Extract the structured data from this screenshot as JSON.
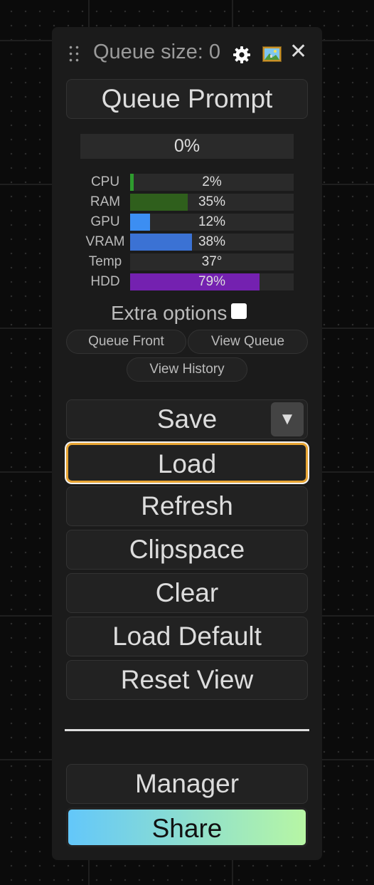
{
  "header": {
    "queue_size_label": "Queue size: 0",
    "gear_icon": "gear-icon",
    "picture_icon": "picture-icon",
    "close_icon": "close-icon",
    "close_glyph": "✕"
  },
  "queue_prompt_label": "Queue Prompt",
  "progress": {
    "value": 0,
    "label": "0%"
  },
  "stats": [
    {
      "name": "CPU",
      "value_label": "2%",
      "fraction": 0.02,
      "color": "#2e9b2e"
    },
    {
      "name": "RAM",
      "value_label": "35%",
      "fraction": 0.35,
      "color": "#2f5f1c"
    },
    {
      "name": "GPU",
      "value_label": "12%",
      "fraction": 0.12,
      "color": "#3c8ef2"
    },
    {
      "name": "VRAM",
      "value_label": "38%",
      "fraction": 0.38,
      "color": "#3b72d4"
    },
    {
      "name": "Temp",
      "value_label": "37°",
      "fraction": 0.0,
      "color": "#8a8a2a"
    },
    {
      "name": "HDD",
      "value_label": "79%",
      "fraction": 0.79,
      "color": "#7421b0"
    }
  ],
  "extra_options": {
    "label": "Extra options",
    "checked": false
  },
  "queue_buttons": {
    "queue_front": "Queue Front",
    "view_queue": "View Queue",
    "view_history": "View History"
  },
  "menu": {
    "save": "Save",
    "save_dropdown_glyph": "▼",
    "load": "Load",
    "refresh": "Refresh",
    "clipspace": "Clipspace",
    "clear": "Clear",
    "load_default": "Load Default",
    "reset_view": "Reset View",
    "manager": "Manager",
    "share": "Share"
  },
  "colors": {
    "load_highlight": "#e8a533",
    "share_gradient_start": "#63c7fa",
    "share_gradient_end": "#b7f6a4"
  }
}
